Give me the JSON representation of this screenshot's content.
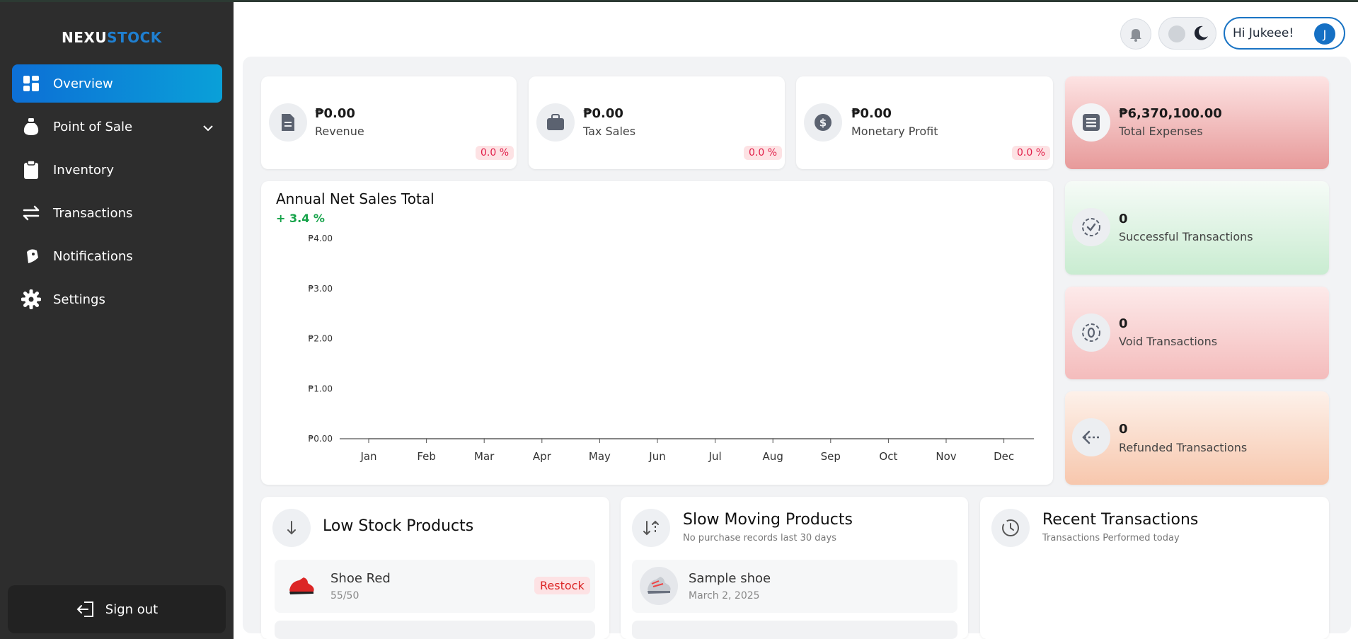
{
  "brand": {
    "part1": "NEXU",
    "part2": "STOCK"
  },
  "sidebar": {
    "items": [
      {
        "label": "Overview",
        "icon": "grid-icon",
        "active": true
      },
      {
        "label": "Point of Sale",
        "icon": "money-bag-icon"
      },
      {
        "label": "Inventory",
        "icon": "clipboard-icon"
      },
      {
        "label": "Transactions",
        "icon": "arrows-swap-icon"
      },
      {
        "label": "Notifications",
        "icon": "bell-tag-icon"
      },
      {
        "label": "Settings",
        "icon": "gear-icon"
      }
    ],
    "signout_label": "Sign out"
  },
  "header": {
    "greeting": "Hi Jukeee!",
    "avatar_initial": "J"
  },
  "stats": {
    "revenue": {
      "value": "₱0.00",
      "label": "Revenue",
      "change": "0.0 %"
    },
    "tax_sales": {
      "value": "₱0.00",
      "label": "Tax Sales",
      "change": "0.0 %"
    },
    "monetary_profit": {
      "value": "₱0.00",
      "label": "Monetary Profit",
      "change": "0.0 %"
    },
    "total_expenses": {
      "value": "₱6,370,100.00",
      "label": "Total Expenses"
    }
  },
  "transactions": {
    "successful": {
      "value": "0",
      "label": "Successful Transactions"
    },
    "void": {
      "value": "0",
      "label": "Void Transactions"
    },
    "refunded": {
      "value": "0",
      "label": "Refunded Transactions"
    }
  },
  "chart_data": {
    "type": "line",
    "title": "Annual Net Sales Total",
    "change": "+ 3.4 %",
    "categories": [
      "Jan",
      "Feb",
      "Mar",
      "Apr",
      "May",
      "Jun",
      "Jul",
      "Aug",
      "Sep",
      "Oct",
      "Nov",
      "Dec"
    ],
    "values": [
      0,
      0,
      0,
      0,
      0,
      0,
      0,
      0,
      0,
      0,
      0,
      0
    ],
    "yticks": [
      "₱0.00",
      "₱1.00",
      "₱2.00",
      "₱3.00",
      "₱4.00"
    ],
    "ylim": [
      0,
      4
    ],
    "grid": false
  },
  "low_stock": {
    "title": "Low Stock Products",
    "items": [
      {
        "name": "Shoe Red",
        "qty": "55/50",
        "action": "Restock"
      }
    ]
  },
  "slow_moving": {
    "title": "Slow Moving Products",
    "subtitle": "No purchase records last 30 days",
    "items": [
      {
        "name": "Sample shoe",
        "date": "March 2, 2025"
      }
    ]
  },
  "recent": {
    "title": "Recent Transactions",
    "subtitle": "Transactions Performed today"
  },
  "colors": {
    "sidebar": "#2d2d2d",
    "accent": "#0d6fd6",
    "expense_card": "#f3b5b5",
    "success_card": "#d7f0dc",
    "void_card": "#f7cfcf",
    "refund_card": "#fad9c8",
    "positive": "#16a34a",
    "negative": "#e11d48"
  }
}
